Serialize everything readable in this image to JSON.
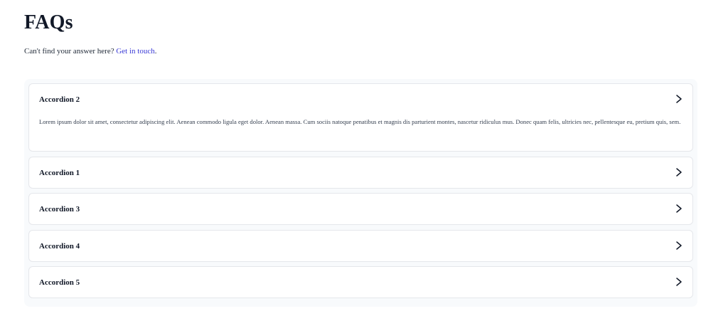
{
  "page": {
    "title": "FAQs",
    "subtitle_text": "Can't find your answer here?",
    "subtitle_link": "Get in touch",
    "subtitle_end": "."
  },
  "accordion": {
    "items": [
      {
        "title": "Accordion 2",
        "expanded": true,
        "body": "Lorem ipsum dolor sit amet, consectetur adipiscing elit. Aenean commodo ligula eget dolor. Aenean massa. Cum sociis natoque penatibus et magnis dis parturient montes, nascetur ridiculus mus. Donec quam felis, ultricies nec, pellentesque eu, pretium quis, sem."
      },
      {
        "title": "Accordion 1",
        "expanded": false
      },
      {
        "title": "Accordion 3",
        "expanded": false
      },
      {
        "title": "Accordion 4",
        "expanded": false
      },
      {
        "title": "Accordion 5",
        "expanded": false
      }
    ]
  },
  "icons": {
    "chevron": "chevron-right-icon"
  },
  "colors": {
    "link": "#3b3bd6",
    "panel_bg": "#f8fafc",
    "border": "#e5e7eb"
  }
}
